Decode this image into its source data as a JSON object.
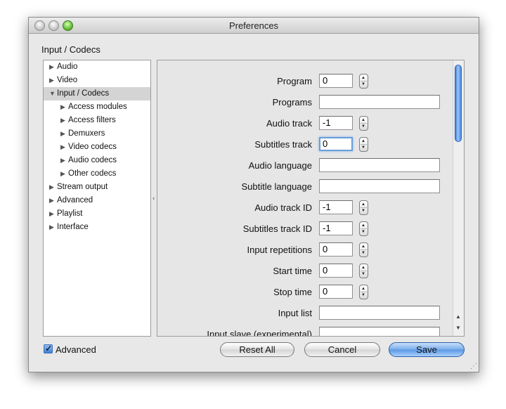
{
  "window": {
    "title": "Preferences"
  },
  "section_title": "Input / Codecs",
  "tree": [
    {
      "label": "Audio",
      "expanded": false,
      "level": 0
    },
    {
      "label": "Video",
      "expanded": false,
      "level": 0
    },
    {
      "label": "Input / Codecs",
      "expanded": true,
      "level": 0,
      "selected": true
    },
    {
      "label": "Access modules",
      "expanded": false,
      "level": 1
    },
    {
      "label": "Access filters",
      "expanded": false,
      "level": 1
    },
    {
      "label": "Demuxers",
      "expanded": false,
      "level": 1
    },
    {
      "label": "Video codecs",
      "expanded": false,
      "level": 1
    },
    {
      "label": "Audio codecs",
      "expanded": false,
      "level": 1
    },
    {
      "label": "Other codecs",
      "expanded": false,
      "level": 1
    },
    {
      "label": "Stream output",
      "expanded": false,
      "level": 0
    },
    {
      "label": "Advanced",
      "expanded": false,
      "level": 0
    },
    {
      "label": "Playlist",
      "expanded": false,
      "level": 0
    },
    {
      "label": "Interface",
      "expanded": false,
      "level": 0
    }
  ],
  "fields": [
    {
      "label": "Program",
      "value": "0",
      "kind": "small",
      "stepper": true
    },
    {
      "label": "Programs",
      "value": "",
      "kind": "wide",
      "stepper": false
    },
    {
      "label": "Audio track",
      "value": "-1",
      "kind": "small",
      "stepper": true
    },
    {
      "label": "Subtitles track",
      "value": "0",
      "kind": "small",
      "stepper": true,
      "focused": true
    },
    {
      "label": "Audio language",
      "value": "",
      "kind": "wide",
      "stepper": false
    },
    {
      "label": "Subtitle language",
      "value": "",
      "kind": "wide",
      "stepper": false
    },
    {
      "label": "Audio track ID",
      "value": "-1",
      "kind": "small",
      "stepper": true
    },
    {
      "label": "Subtitles track ID",
      "value": "-1",
      "kind": "small",
      "stepper": true
    },
    {
      "label": "Input repetitions",
      "value": "0",
      "kind": "small",
      "stepper": true
    },
    {
      "label": "Start time",
      "value": "0",
      "kind": "small",
      "stepper": true
    },
    {
      "label": "Stop time",
      "value": "0",
      "kind": "small",
      "stepper": true
    },
    {
      "label": "Input list",
      "value": "",
      "kind": "wide",
      "stepper": false
    },
    {
      "label": "Input slave (experimental)",
      "value": "",
      "kind": "wide",
      "stepper": false
    }
  ],
  "advanced": {
    "label": "Advanced",
    "checked": true
  },
  "buttons": {
    "reset": "Reset All",
    "cancel": "Cancel",
    "save": "Save"
  },
  "icons": {
    "arrow_collapsed": "▶",
    "arrow_expanded": "▼",
    "stepper_up": "▲",
    "stepper_down": "▼",
    "checkmark": "✓"
  },
  "colors": {
    "accent": "#5b97e4",
    "selection": "#d4d4d4"
  }
}
